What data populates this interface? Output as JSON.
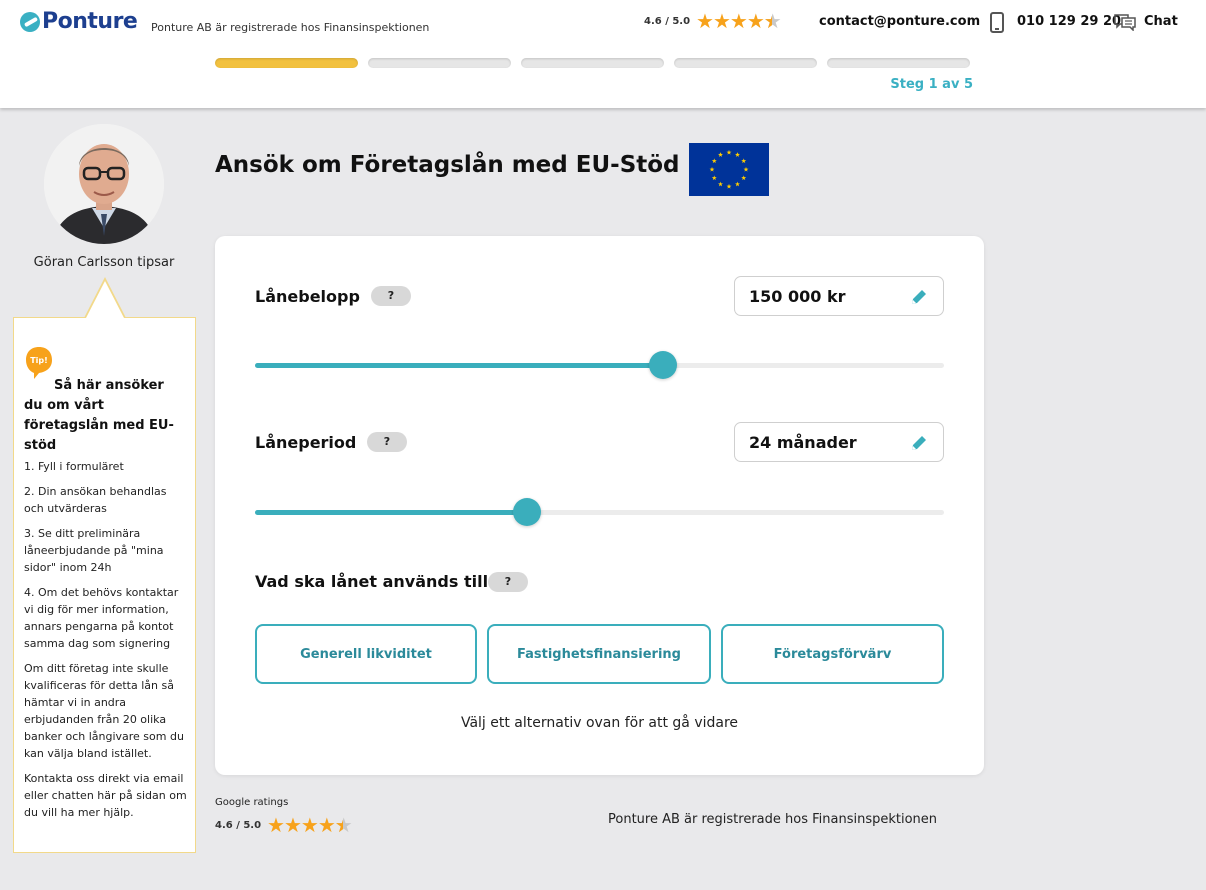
{
  "header": {
    "logo_text": "Ponture",
    "registration": "Ponture AB är registrerade hos Finansinspektionen",
    "rating": "4.6 / 5.0",
    "rating_value": 4.6,
    "email": "contact@ponture.com",
    "phone": "010 129 29 20",
    "chat_label": "Chat",
    "step_label": "Steg 1 av 5",
    "progress": {
      "current_step": 1,
      "total_steps": 5
    }
  },
  "advisor": {
    "name": "Göran Carlsson tipsar",
    "tip_badge": "Tip!",
    "tip_heading": "Så här ansöker du om vårt företagslån med EU-stöd",
    "tip_paragraphs": [
      "1. Fyll i formuläret",
      "2. Din ansökan behandlas och utvärderas",
      "3. Se ditt preliminära låneerbjudande på \"mina sidor\" inom 24h",
      "4. Om det behövs kontaktar vi dig för mer information, annars pengarna på kontot samma dag som signering",
      "Om ditt företag inte skulle kvalificeras för detta lån så hämtar vi in andra erbjudanden från 20 olika banker och långivare som du kan välja bland istället.",
      "Kontakta oss direkt via email eller chatten här på sidan om du vill ha mer hjälp."
    ]
  },
  "main": {
    "title": "Ansök om Företagslån med EU-Stöd",
    "loan_amount": {
      "label": "Lånebelopp",
      "help": "?",
      "value": "150 000 kr",
      "slider_fraction": 0.592
    },
    "loan_period": {
      "label": "Låneperiod",
      "help": "?",
      "value": "24 månader",
      "slider_fraction": 0.395
    },
    "purpose": {
      "label": "Vad ska lånet används till",
      "help": "?",
      "options": [
        "Generell likviditet",
        "Fastighetsfinansiering",
        "Företagsförvärv"
      ]
    },
    "hint": "Välj ett alternativ ovan för att gå vidare"
  },
  "footer": {
    "google_label": "Google ratings",
    "rating": "4.6 / 5.0",
    "rating_value": 4.6,
    "registration": "Ponture AB är registrerade hos Finansinspektionen"
  },
  "colors": {
    "accent": "#3aaebc",
    "progress_active": "#f2c13f",
    "star": "#f7a21b",
    "brand_blue": "#1d3f8f",
    "eu_blue": "#003399"
  }
}
